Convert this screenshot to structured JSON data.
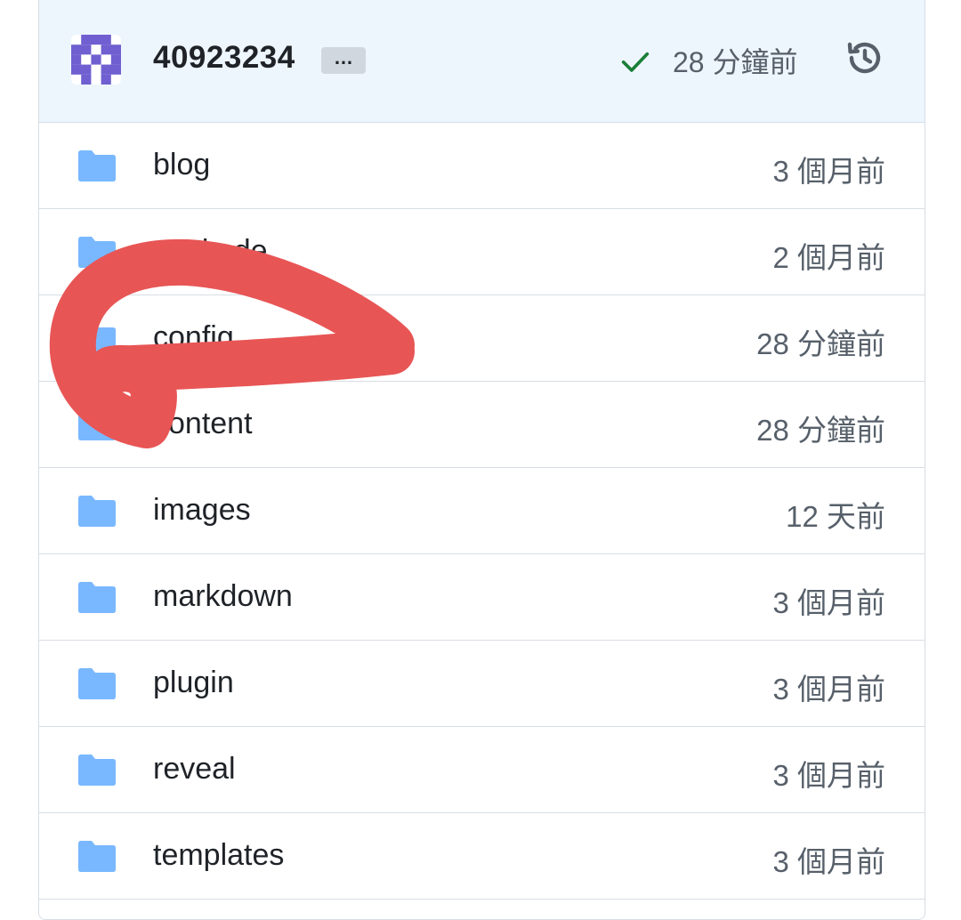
{
  "header": {
    "commit_sha": "40923234",
    "more_label": "…",
    "commit_time": "28 分鐘前",
    "status": "success",
    "avatar_icon": "identicon-avatar",
    "history_icon": "history-icon"
  },
  "rows": [
    {
      "name": "blog",
      "time": "3 個月前",
      "type": "folder"
    },
    {
      "name": "easimde",
      "time": "2 個月前",
      "type": "folder"
    },
    {
      "name": "config",
      "time": "28 分鐘前",
      "type": "folder"
    },
    {
      "name": "content",
      "time": "28 分鐘前",
      "type": "folder"
    },
    {
      "name": "images",
      "time": "12 天前",
      "type": "folder"
    },
    {
      "name": "markdown",
      "time": "3 個月前",
      "type": "folder"
    },
    {
      "name": "plugin",
      "time": "3 個月前",
      "type": "folder"
    },
    {
      "name": "reveal",
      "time": "3 個月前",
      "type": "folder"
    },
    {
      "name": "templates",
      "time": "3 個月前",
      "type": "folder"
    }
  ],
  "colors": {
    "header_bg": "#eef6fd",
    "folder": "#79b8ff",
    "check": "#1a7f37",
    "avatar": "#6f5fd0",
    "annotation": "#e85555"
  }
}
